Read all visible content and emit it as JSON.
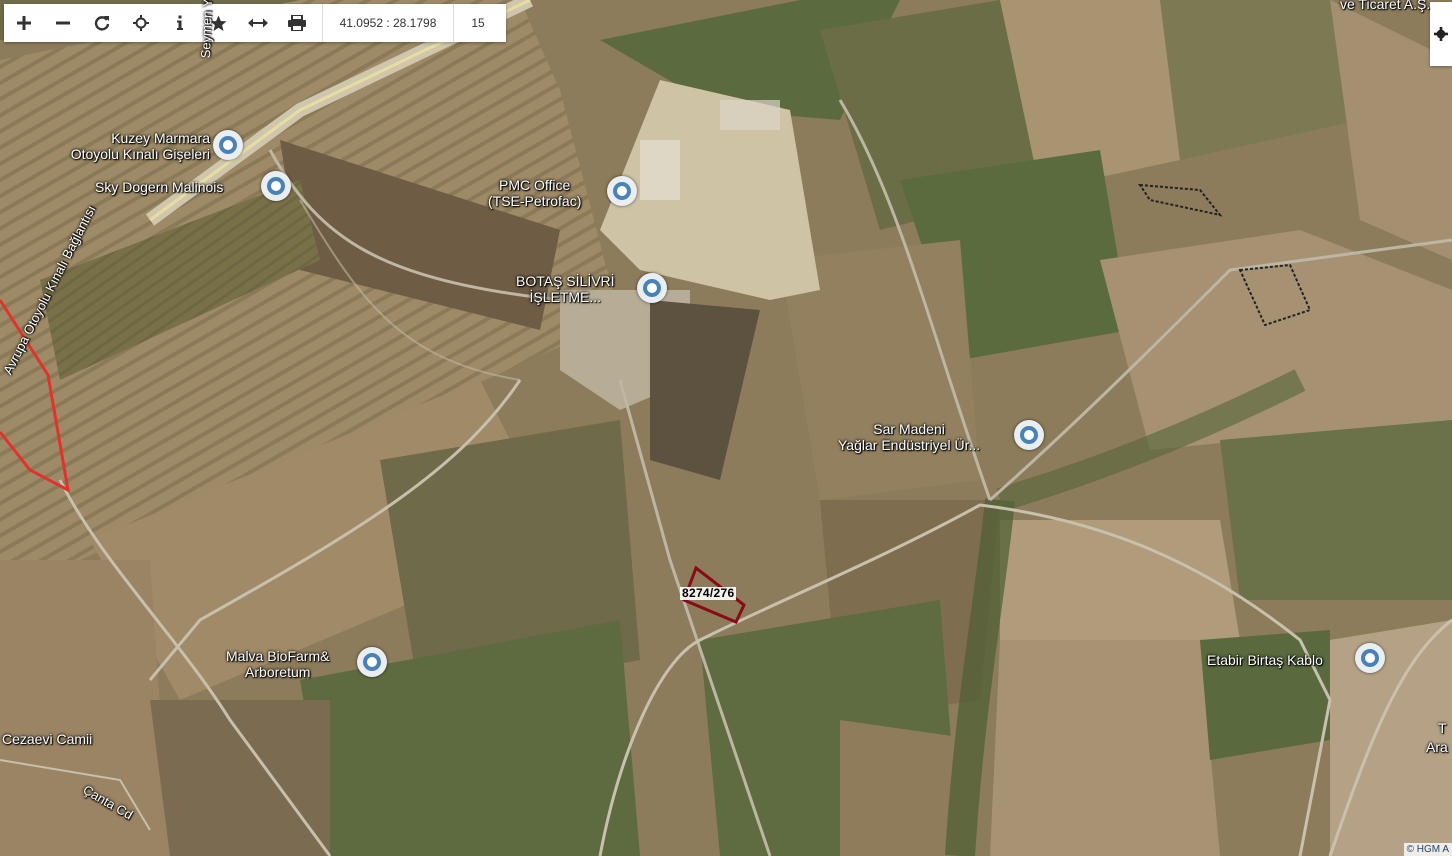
{
  "toolbar": {
    "buttons": [
      {
        "name": "zoom-in-button",
        "icon": "plus-icon"
      },
      {
        "name": "zoom-out-button",
        "icon": "minus-icon"
      },
      {
        "name": "refresh-button",
        "icon": "refresh-icon"
      },
      {
        "name": "locate-button",
        "icon": "crosshair-icon"
      },
      {
        "name": "info-button",
        "icon": "info-icon"
      },
      {
        "name": "favorite-button",
        "icon": "star-icon"
      },
      {
        "name": "measure-button",
        "icon": "arrows-horizontal-icon"
      },
      {
        "name": "print-button",
        "icon": "printer-icon"
      }
    ],
    "coordinates": "41.0952 : 28.1798",
    "zoom_level": "15"
  },
  "map": {
    "places": [
      {
        "name": "Kuzey Marmara\nOtoyolu Kınalı Gişeleri"
      },
      {
        "name": "Sky Dogern Malinois"
      },
      {
        "name": "PMC Office\n(TSE-Petrofac)"
      },
      {
        "name": "BOTAŞ SİLİVRİ\nİŞLETME..."
      },
      {
        "name": "Sar Madeni\nYağlar Endüstriyel Ür..."
      },
      {
        "name": "Malva BioFarm&\nArboretum"
      },
      {
        "name": "Etabir Birtaş Kablo"
      }
    ],
    "road_labels": {
      "seymen": "Seymen Yo",
      "kinali": "Avrupa Otoyolu Kınalı Bağlantısı",
      "canta": "Çanta Cd"
    },
    "edge_labels": {
      "top_right": "ve Ticaret A.Ş.",
      "right_1": "T",
      "right_2": "Ara"
    },
    "area_labels": {
      "mosque": "Cezaevi Camii"
    },
    "parcel": "8274/276",
    "attribution": "© HGM A"
  },
  "colors": {
    "boundary": "#e2322b",
    "parcel": "#8b0a17",
    "pin": "#4a82b8"
  }
}
